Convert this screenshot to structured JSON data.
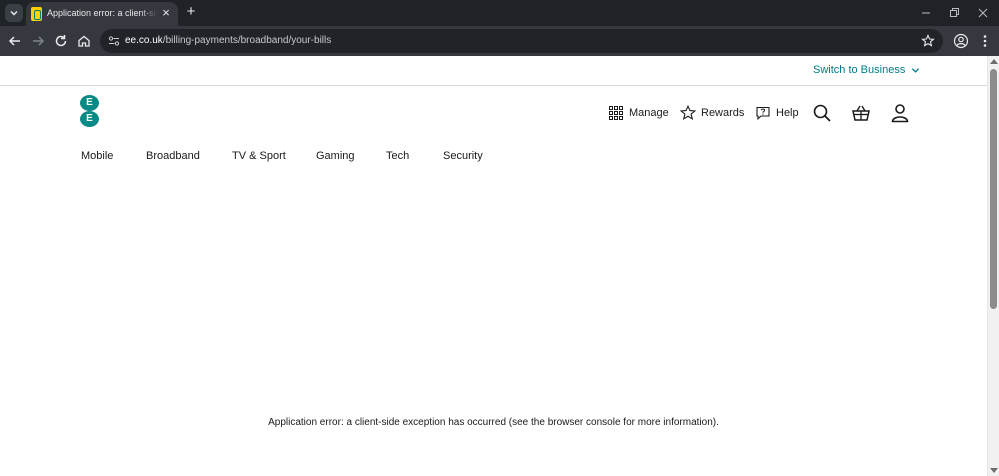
{
  "browser": {
    "tab_title": "Application error: a client-side exception has occurred",
    "new_tab_symbol": "+",
    "close_symbol": "×",
    "url_host": "ee.co.uk",
    "url_path": "/billing-payments/broadband/your-bills"
  },
  "header": {
    "switch_business": "Switch to Business",
    "logo_letters": [
      "E",
      "E"
    ],
    "utility": {
      "manage": "Manage",
      "rewards": "Rewards",
      "help": "Help"
    },
    "nav": [
      "Mobile",
      "Broadband",
      "TV & Sport",
      "Gaming",
      "Tech",
      "Security"
    ]
  },
  "main": {
    "error_message": "Application error: a client-side exception has occurred (see the browser console for more information)."
  },
  "colors": {
    "brand_teal": "#007b85",
    "logo_teal": "#0a8a86"
  }
}
